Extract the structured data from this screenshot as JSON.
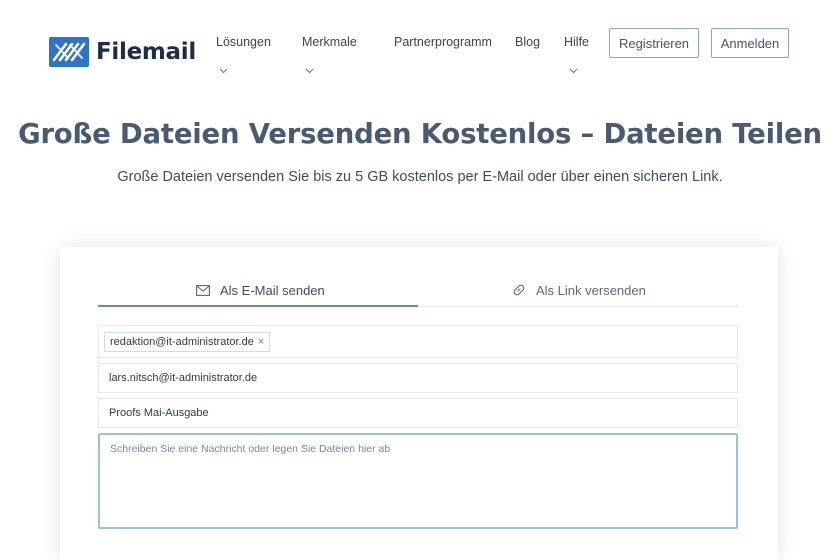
{
  "brand": {
    "name": "Filemail",
    "color": "#2f73c9",
    "icon": "filemail-logo-icon"
  },
  "nav": {
    "items": [
      {
        "label": "Lösungen",
        "has_dropdown": true
      },
      {
        "label": "Merkmale",
        "has_dropdown": true
      },
      {
        "label": "Partnerprogramm",
        "has_dropdown": false
      },
      {
        "label": "Blog",
        "has_dropdown": false
      },
      {
        "label": "Hilfe",
        "has_dropdown": true
      }
    ],
    "register_label": "Registrieren",
    "login_label": "Anmelden"
  },
  "hero": {
    "title": "Große Dateien Versenden Kostenlos – Dateien Teilen",
    "subtitle": "Große Dateien versenden Sie bis zu 5 GB kostenlos per E-Mail oder über einen sicheren Link."
  },
  "form": {
    "tabs": [
      {
        "label": "Als E-Mail senden",
        "icon": "envelope-icon",
        "active": true
      },
      {
        "label": "Als Link versenden",
        "icon": "link-icon",
        "active": false
      }
    ],
    "recipient_chip": "redaktion@it-administrator.de",
    "recipient_chip_remove": "×",
    "sender_value": "lars.nitsch@it-administrator.de",
    "subject_value": "Proofs Mai-Ausgabe",
    "message_placeholder": "Schreiben Sie eine Nachricht oder legen Sie Dateien hier ab"
  },
  "colors": {
    "accent": "#6a8bb3",
    "focus_border": "#9ac0e3",
    "button_border": "#8ea4bf"
  }
}
